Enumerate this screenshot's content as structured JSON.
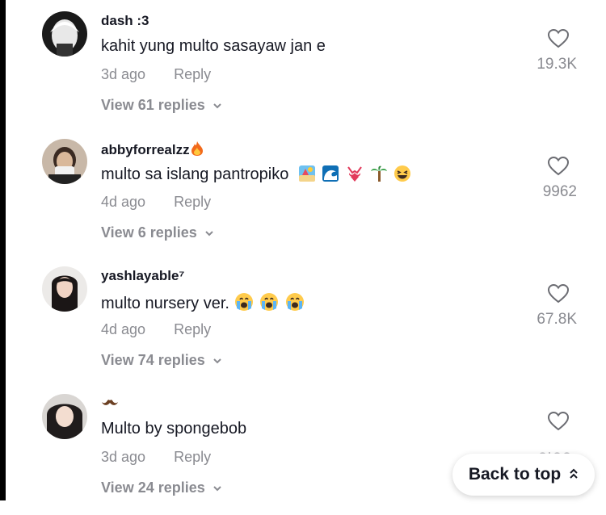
{
  "comments": [
    {
      "username": "dash :3",
      "text": "kahit yung multo sasayaw jan e",
      "time": "3d ago",
      "reply_label": "Reply",
      "likes": "19.3K",
      "view_replies": "View 61 replies",
      "emojis": []
    },
    {
      "username": "abbyforrealzz",
      "username_emoji": "fire-emoji",
      "text": "multo sa islang pantropiko",
      "time": "4d ago",
      "reply_label": "Reply",
      "likes": "9962",
      "view_replies": "View 6 replies",
      "emojis": [
        "beach-emoji",
        "wave-emoji",
        "bikini-emoji",
        "palm-tree-emoji",
        "laughing-emoji"
      ]
    },
    {
      "username": "yashlayable⁷",
      "text": "multo nursery ver.",
      "time": "4d ago",
      "reply_label": "Reply",
      "likes": "67.8K",
      "view_replies": "View 74 replies",
      "emojis": [
        "crying-emoji",
        "crying-emoji",
        "crying-emoji"
      ]
    },
    {
      "username_emoji": "mustache-emoji",
      "text": "Multo by spongebob",
      "time": "3d ago",
      "reply_label": "Reply",
      "likes": "",
      "view_replies": "View 24 replies",
      "emojis": []
    }
  ],
  "back_to_top": {
    "label": "Back to top",
    "icon": "double-chevron-up-icon"
  },
  "colors": {
    "text": "#161823",
    "muted": "#8a8b91",
    "background": "#ffffff"
  }
}
